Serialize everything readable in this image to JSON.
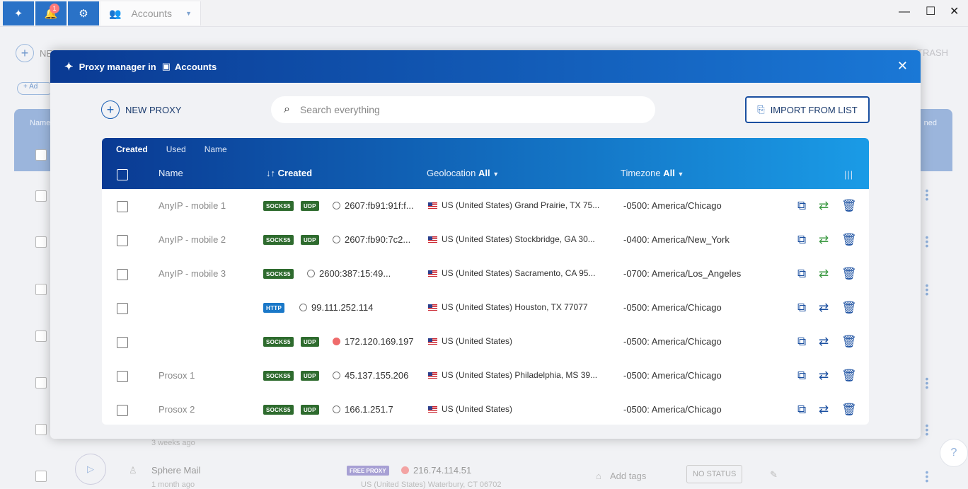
{
  "titlebar": {
    "notifications_count": "1",
    "tab_label": "Accounts"
  },
  "background": {
    "header_left": "Name",
    "header_right": "ned",
    "trash_label": "TRASH",
    "add_label": "Ad",
    "new_label": "NE",
    "row": {
      "name": "Sphere Mail",
      "age": "1 month ago",
      "prev_age": "3 weeks ago",
      "tag": "FREE PROXY",
      "ip": "216.74.114.51",
      "geo": "US (United States) Waterbury, CT 06702",
      "add_tags": "Add tags",
      "status": "NO STATUS"
    }
  },
  "modal": {
    "title": "Proxy manager in",
    "context": "Accounts",
    "new_proxy_label": "NEW PROXY",
    "search_placeholder": "Search everything",
    "import_label": "IMPORT FROM LIST",
    "sort_tabs": [
      "Created",
      "Used",
      "Name"
    ],
    "active_sort": "Created",
    "columns": {
      "name": "Name",
      "created": "Created",
      "geolocation": "Geolocation",
      "geolocation_filter": "All",
      "timezone": "Timezone",
      "timezone_filter": "All"
    },
    "rows": [
      {
        "name": "AnyIP - mobile  1",
        "tags": [
          "SOCKS5",
          "UDP"
        ],
        "ip": "2607:fb91:91f:f...",
        "status": "idle",
        "geo": "US (United States) Grand Prairie, TX 75...",
        "tz": "-0500: America/Chicago",
        "rotate_color": "green"
      },
      {
        "name": "AnyIP - mobile  2",
        "tags": [
          "SOCKS5",
          "UDP"
        ],
        "ip": "2607:fb90:7c2...",
        "status": "idle",
        "geo": "US (United States) Stockbridge, GA 30...",
        "tz": "-0400: America/New_York",
        "rotate_color": "green"
      },
      {
        "name": "AnyIP - mobile  3",
        "tags": [
          "SOCKS5"
        ],
        "ip": "2600:387:15:49...",
        "status": "idle",
        "geo": "US (United States) Sacramento, CA 95...",
        "tz": "-0700: America/Los_Angeles",
        "rotate_color": "green"
      },
      {
        "name": "",
        "tags": [
          "HTTP"
        ],
        "ip": "99.111.252.114",
        "status": "idle",
        "geo": "US (United States) Houston, TX 77077",
        "tz": "-0500: America/Chicago",
        "rotate_color": "blue"
      },
      {
        "name": "",
        "tags": [
          "SOCKS5",
          "UDP"
        ],
        "ip": "172.120.169.197",
        "status": "error",
        "geo": "US (United States)",
        "tz": "-0500: America/Chicago",
        "rotate_color": "blue"
      },
      {
        "name": "Prosox 1",
        "tags": [
          "SOCKS5",
          "UDP"
        ],
        "ip": "45.137.155.206",
        "status": "idle",
        "geo": "US (United States) Philadelphia, MS 39...",
        "tz": "-0500: America/Chicago",
        "rotate_color": "blue"
      },
      {
        "name": "Prosox 2",
        "tags": [
          "SOCKS5",
          "UDP"
        ],
        "ip": "166.1.251.7",
        "status": "idle",
        "geo": "US (United States)",
        "tz": "-0500: America/Chicago",
        "rotate_color": "blue"
      }
    ]
  },
  "colors": {
    "brand": "#0a3a93",
    "accent": "#1a9be6",
    "socks_tag": "#2e6b2e",
    "http_tag": "#1a78c8",
    "error_status": "#ef6b6b"
  }
}
